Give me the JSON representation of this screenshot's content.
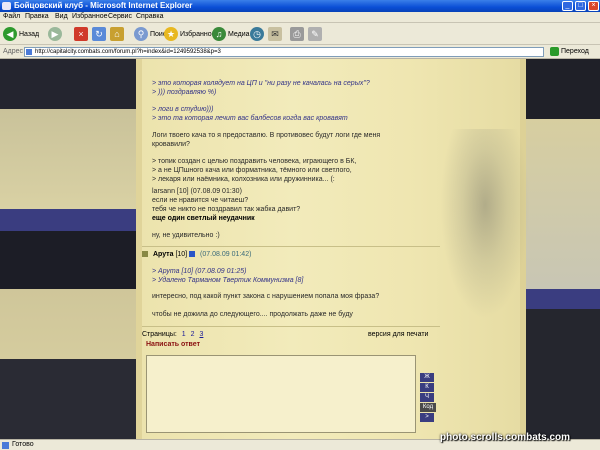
{
  "window": {
    "title": "Бойцовский клуб - Microsoft Internet Explorer"
  },
  "menu": [
    "Файл",
    "Правка",
    "Вид",
    "Избранное",
    "Сервис",
    "Справка"
  ],
  "toolbar": {
    "back_label": "Назад",
    "search_label": "Поиск",
    "favorites_label": "Избранное",
    "media_label": "Медиа"
  },
  "address": {
    "label": "Адрес",
    "url": "http://capitalcity.combats.com/forum.pl?h=index&id=1249592538&p=3",
    "go_label": "Переход"
  },
  "post1": {
    "lines": [
      "> это которая колядует на ЦП и \"ни разу не качалась на серых\"?",
      "> ))) поздравляю %)",
      "> логи в студию)))",
      "> это та которая лечит вас балбесов когда вас кровавят",
      "Логи твоего кача то я предоставлю. В противовес будут логи где меня",
      "кровавили?",
      "> топик создан с целью поздравить человека, играющего в БК,",
      "> а не ЦПшного кача или форматника, тёмного или светлого,",
      "> лекаря или наёмника, колхозника или дружинника... (:",
      "larsann [10]    (07.08.09 01:30)",
      "если не нравится че читаеш?",
      "тебя че никто не поздравил так жабка давит?",
      "еще один светлый неудачник",
      "ну, не удивительно :)"
    ]
  },
  "post2": {
    "author": "Арута",
    "level": "[10]",
    "date": "(07.08.09 01:42)",
    "quote1": "> Арута [10]   (07.08.09 01:25)",
    "quote2": "> Удалено Тарманом   Твертик Коммунизма [8]",
    "text1": "интересно, под какой пункт закона с нарушением попала моя фраза?",
    "text2": "чтобы не дожила до следующего.... продолжать даже не буду"
  },
  "pager": {
    "label": "Страницы:",
    "pages": [
      "1",
      "2",
      "3"
    ],
    "current": "3",
    "print_label": "версия для печати"
  },
  "reply": {
    "label": "Написать ответ",
    "format_buttons": [
      "Ж",
      "К",
      "Ч",
      "Код",
      ">"
    ]
  },
  "status": {
    "text": "Готово"
  },
  "watermark": "photo.scrolls.combats.com"
}
